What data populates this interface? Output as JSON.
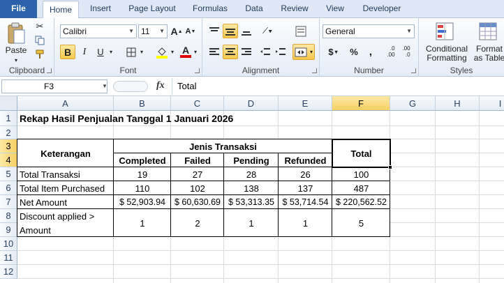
{
  "ribbon_tabs": [
    "File",
    "Home",
    "Insert",
    "Page Layout",
    "Formulas",
    "Data",
    "Review",
    "View",
    "Developer"
  ],
  "clipboard": {
    "paste_label": "Paste",
    "group_label": "Clipboard"
  },
  "font": {
    "name": "Calibri",
    "size": "11",
    "bold": "B",
    "italic": "I",
    "underline": "U",
    "grow": "A",
    "shrink": "A",
    "color_letter": "A",
    "group_label": "Font"
  },
  "alignment": {
    "group_label": "Alignment"
  },
  "number": {
    "format": "General",
    "currency": "$",
    "percent": "%",
    "comma": ",",
    "inc_decimal": ".0\n.00",
    "dec_decimal": ".00\n.0",
    "group_label": "Number"
  },
  "styles": {
    "conditional": "Conditional\nFormatting",
    "format_table": "Format\nas Table",
    "group_label": "Styles"
  },
  "formula_bar": {
    "name_box": "F3",
    "fx": "fx",
    "content": "Total"
  },
  "colors": {
    "accent": "#2b62a9",
    "selection": "#f8cf62",
    "grid": "#dadcdd"
  },
  "sheet": {
    "columns": [
      "A",
      "B",
      "C",
      "D",
      "E",
      "F",
      "G",
      "H",
      "I"
    ],
    "rows": [
      "1",
      "2",
      "3",
      "4",
      "5",
      "6",
      "7",
      "8",
      "9",
      "10",
      "11",
      "12"
    ],
    "title": "Rekap Hasil Penjualan Tanggal 1 Januari 2026",
    "hdr_keterangan": "Keterangan",
    "hdr_jenis": "Jenis Transaksi",
    "hdr_total": "Total",
    "sub_headers": [
      "Completed",
      "Failed",
      "Pending",
      "Refunded"
    ],
    "data_rows": [
      {
        "label": "Total Transaksi",
        "values": [
          "19",
          "27",
          "28",
          "26",
          "100"
        ]
      },
      {
        "label": "Total Item Purchased",
        "values": [
          "110",
          "102",
          "138",
          "137",
          "487"
        ]
      },
      {
        "label": "Net Amount",
        "values": [
          "$ 52,903.94",
          "$ 60,630.69",
          "$ 53,313.35",
          "$ 53,714.54",
          "$ 220,562.52"
        ]
      }
    ],
    "discount_label_1": "Discount applied >",
    "discount_label_2": "Amount",
    "discount_values": [
      "1",
      "2",
      "1",
      "1",
      "5"
    ]
  }
}
